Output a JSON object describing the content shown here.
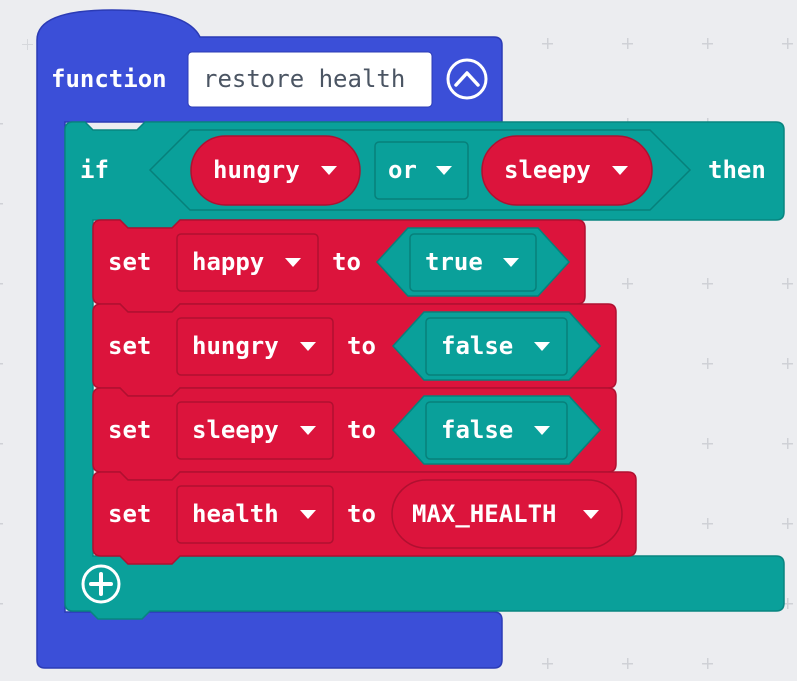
{
  "function_block": {
    "keyword": "function",
    "name": "restore health",
    "collapse_icon": "chevron-up-icon"
  },
  "if_block": {
    "keyword": "if",
    "condition": {
      "left": "hungry",
      "operator": "or",
      "right": "sleepy"
    },
    "then_label": "then",
    "add_icon": "plus-circle-icon"
  },
  "set_blocks": [
    {
      "keyword": "set",
      "variable": "happy",
      "to": "to",
      "value": "true"
    },
    {
      "keyword": "set",
      "variable": "hungry",
      "to": "to",
      "value": "false"
    },
    {
      "keyword": "set",
      "variable": "sleepy",
      "to": "to",
      "value": "false"
    },
    {
      "keyword": "set",
      "variable": "health",
      "to": "to",
      "value": "MAX_HEALTH"
    }
  ],
  "colors": {
    "function": "#3b4fd8",
    "logic": "#0aa09a",
    "variables": "#dc143c",
    "background": "#ecedf0"
  }
}
